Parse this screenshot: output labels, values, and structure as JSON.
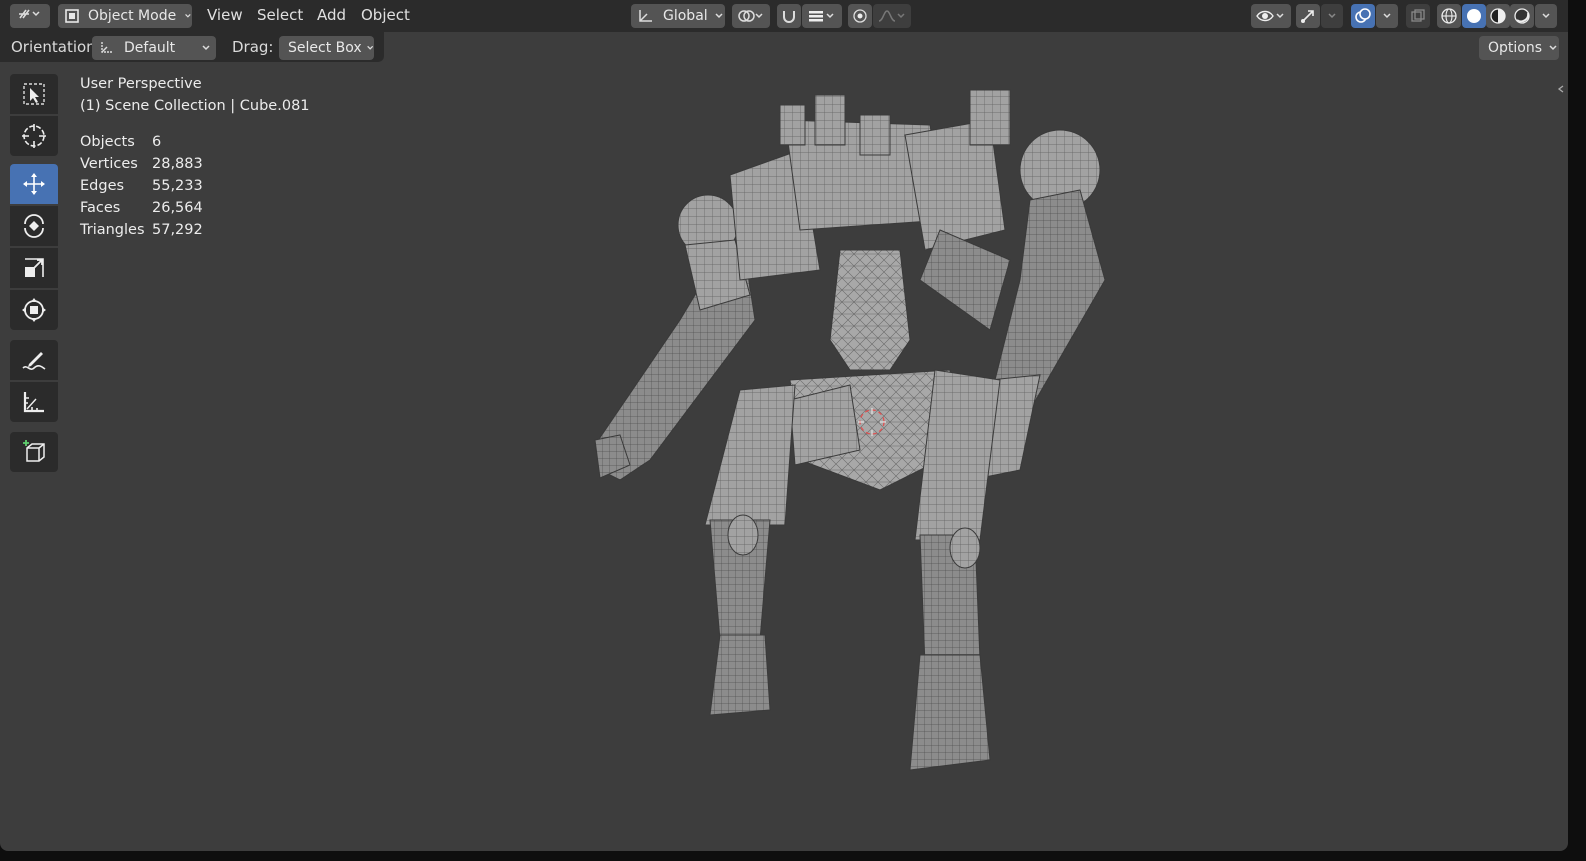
{
  "header": {
    "mode": "Object Mode",
    "menus": [
      "View",
      "Select",
      "Add",
      "Object"
    ],
    "transform_orientation": "Global"
  },
  "tool_header": {
    "orientation_label": "Orientation:",
    "orientation_value": "Default",
    "drag_label": "Drag:",
    "drag_value": "Select Box",
    "options_label": "Options"
  },
  "overlay": {
    "view_name": "User Perspective",
    "collection_line": "(1) Scene Collection | Cube.081",
    "stats": [
      {
        "label": "Objects",
        "value": "6"
      },
      {
        "label": "Vertices",
        "value": "28,883"
      },
      {
        "label": "Edges",
        "value": "55,233"
      },
      {
        "label": "Faces",
        "value": "26,564"
      },
      {
        "label": "Triangles",
        "value": "57,292"
      }
    ]
  },
  "toolbar": {
    "tools": [
      "select-box-icon",
      "cursor-icon",
      "move-icon",
      "rotate-icon",
      "scale-icon",
      "transform-icon",
      "annotate-icon",
      "measure-icon",
      "add-cube-icon"
    ],
    "active_tool": "move-icon"
  },
  "colors": {
    "viewport_bg": "#3d3d3d",
    "header_bg": "#2b2b2b",
    "button_bg": "#545454",
    "accent": "#4772b3",
    "mesh": "#9a9a9a"
  }
}
